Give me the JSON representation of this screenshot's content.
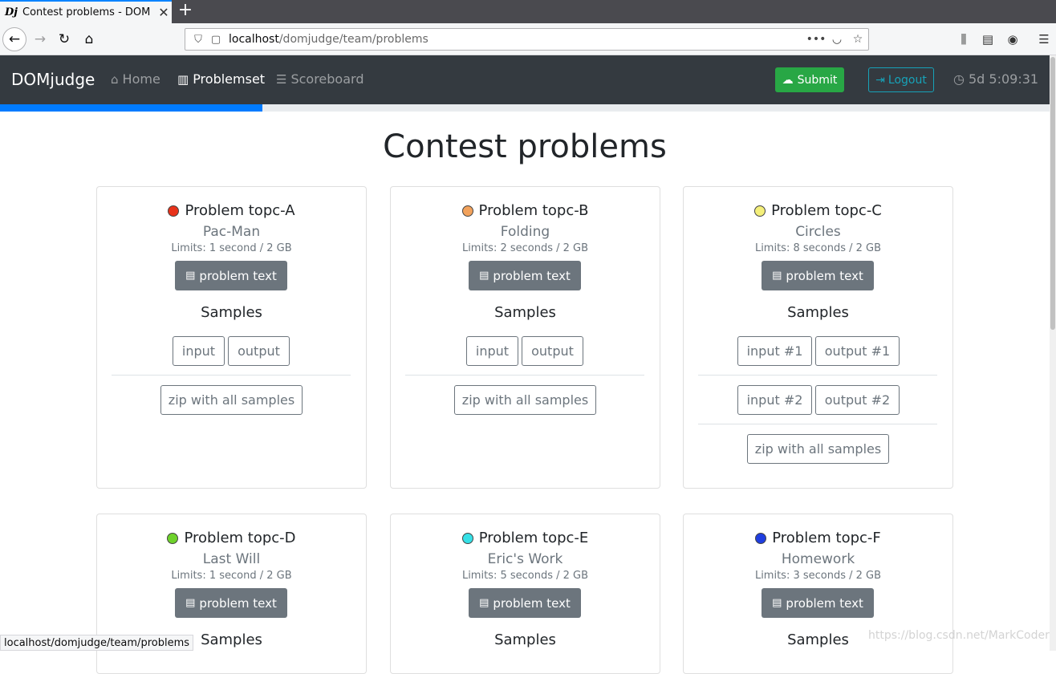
{
  "browser": {
    "tab_title": "Contest problems - DOM",
    "favicon": "Dj",
    "url_host": "localhost",
    "url_path": "/domjudge/team/problems",
    "status_url": "localhost/domjudge/team/problems"
  },
  "nav": {
    "brand": "DOMjudge",
    "home": "Home",
    "problemset": "Problemset",
    "scoreboard": "Scoreboard",
    "submit": "Submit",
    "logout": "Logout",
    "clock": "5d 5:09:31"
  },
  "progress_fraction": 0.25,
  "page": {
    "title": "Contest problems"
  },
  "problems": [
    {
      "label": "Problem topc-A",
      "name": "Pac-Man",
      "limits": "Limits: 1 second / 2 GB",
      "color": "#e8321a",
      "button": "problem text",
      "samples_heading": "Samples",
      "samples": [
        [
          "input",
          "output"
        ]
      ],
      "zip": "zip with all samples"
    },
    {
      "label": "Problem topc-B",
      "name": "Folding",
      "limits": "Limits: 2 seconds / 2 GB",
      "color": "#f2a25c",
      "button": "problem text",
      "samples_heading": "Samples",
      "samples": [
        [
          "input",
          "output"
        ]
      ],
      "zip": "zip with all samples"
    },
    {
      "label": "Problem topc-C",
      "name": "Circles",
      "limits": "Limits: 8 seconds / 2 GB",
      "color": "#f4ef7a",
      "button": "problem text",
      "samples_heading": "Samples",
      "samples": [
        [
          "input #1",
          "output #1"
        ],
        [
          "input #2",
          "output #2"
        ]
      ],
      "zip": "zip with all samples"
    },
    {
      "label": "Problem topc-D",
      "name": "Last Will",
      "limits": "Limits: 1 second / 2 GB",
      "color": "#6ed22b",
      "button": "problem text",
      "samples_heading": "Samples"
    },
    {
      "label": "Problem topc-E",
      "name": "Eric's Work",
      "limits": "Limits: 5 seconds / 2 GB",
      "color": "#36e0e6",
      "button": "problem text",
      "samples_heading": "Samples"
    },
    {
      "label": "Problem topc-F",
      "name": "Homework",
      "limits": "Limits: 3 seconds / 2 GB",
      "color": "#1f3ee0",
      "button": "problem text",
      "samples_heading": "Samples"
    }
  ],
  "watermark": "https://blog.csdn.net/MarkCoder",
  "icons": {
    "home": "home-icon",
    "book": "book-icon",
    "list": "list-icon",
    "cloud": "cloud-upload-icon",
    "signout": "sign-out-icon",
    "clock": "clock-icon",
    "pdf": "file-pdf-icon"
  }
}
